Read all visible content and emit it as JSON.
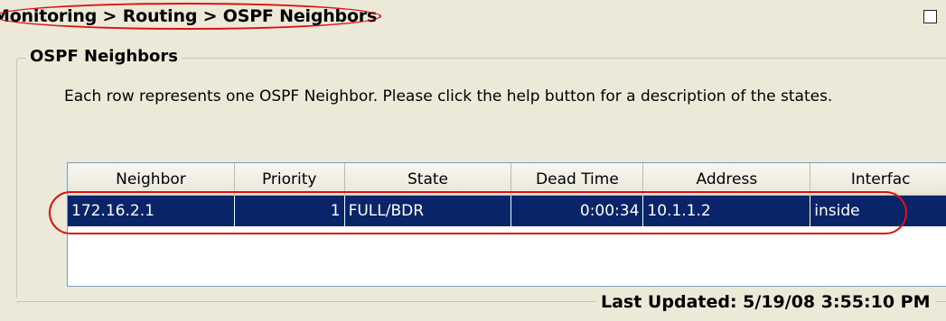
{
  "breadcrumb": "Monitoring > Routing > OSPF Neighbors",
  "group": {
    "title": "OSPF Neighbors",
    "description": "Each row represents one OSPF Neighbor. Please click the help button for a description of the states.",
    "last_updated": "Last Updated: 5/19/08 3:55:10 PM"
  },
  "table": {
    "headers": [
      "Neighbor",
      "Priority",
      "State",
      "Dead Time",
      "Address",
      "Interfac"
    ],
    "rows": [
      {
        "neighbor": "172.16.2.1",
        "priority": "1",
        "state": "FULL/BDR",
        "dead_time": "0:00:34",
        "address": "10.1.1.2",
        "interface": "inside"
      }
    ]
  },
  "colors": {
    "selection": "#0a246a",
    "annotation": "#dd1111",
    "panel": "#ece9d8"
  },
  "icons": {
    "maximize": "maximize-icon"
  }
}
